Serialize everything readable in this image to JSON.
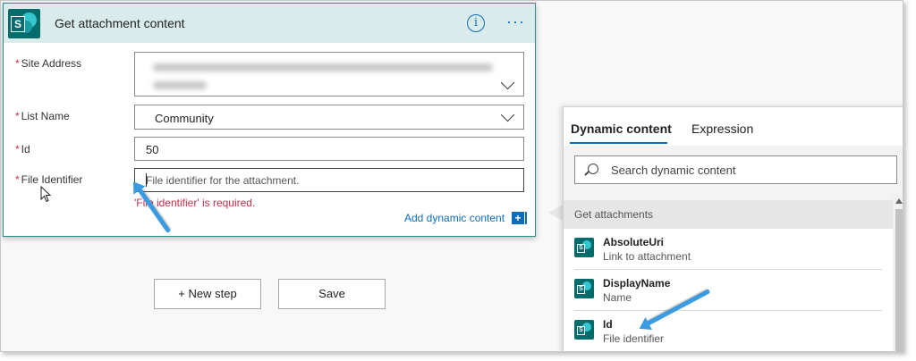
{
  "card": {
    "title": "Get attachment content",
    "info_glyph": "i",
    "more_glyph": "···",
    "logo_letter": "S"
  },
  "fields": {
    "required_mark": "*",
    "site_address_label": "Site Address",
    "list_name_label": "List Name",
    "list_name_value": "Community",
    "id_label": "Id",
    "id_value": "50",
    "file_identifier_label": "File Identifier",
    "file_identifier_placeholder": "File identifier for the attachment.",
    "error_text": "'File identifier' is required.",
    "add_dynamic_label": "Add dynamic content",
    "add_dynamic_glyph": "+"
  },
  "actions": {
    "new_step_label": "+ New step",
    "save_label": "Save"
  },
  "panel": {
    "tab_dynamic": "Dynamic content",
    "tab_expression": "Expression",
    "search_placeholder": "Search dynamic content",
    "section_title": "Get attachments",
    "items": [
      {
        "name": "AbsoluteUri",
        "desc": "Link to attachment"
      },
      {
        "name": "DisplayName",
        "desc": "Name"
      },
      {
        "name": "Id",
        "desc": "File identifier"
      }
    ]
  },
  "colors": {
    "accent": "#0f6cbd",
    "error": "#c4314b",
    "sharepoint_teal": "#056b6b",
    "header_bg": "#d9ebeb",
    "arrow": "#3a9be0"
  },
  "icons": [
    "sharepoint-icon",
    "info-icon",
    "more-icon",
    "chevron-down-icon",
    "search-icon",
    "add-icon",
    "scroll-up-icon"
  ]
}
